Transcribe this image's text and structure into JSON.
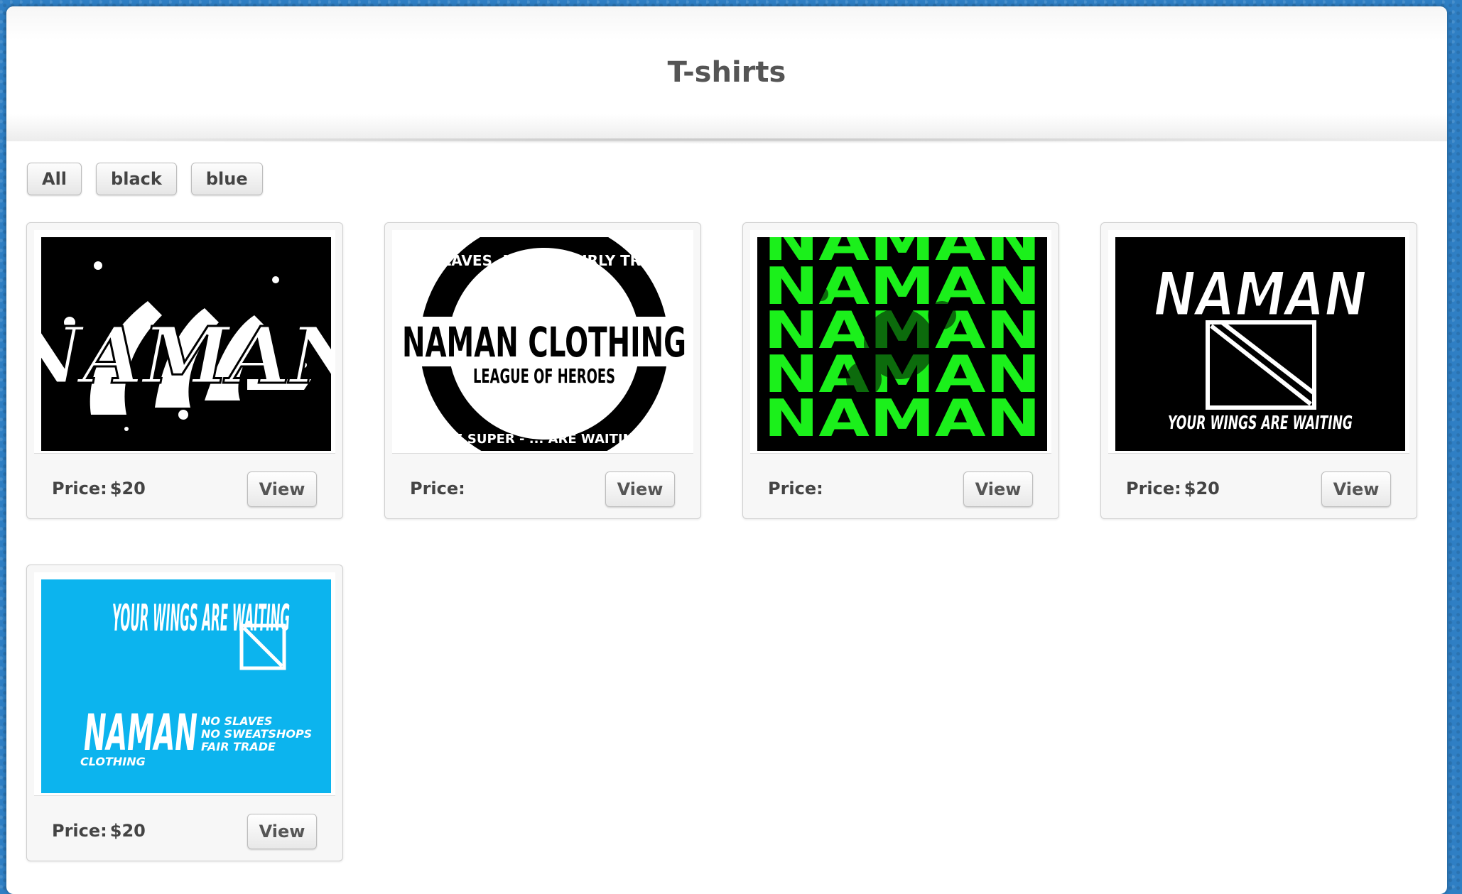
{
  "page": {
    "title": "T-shirts"
  },
  "filters": [
    {
      "label": "All"
    },
    {
      "label": "black"
    },
    {
      "label": "blue"
    }
  ],
  "products": [
    {
      "image_text": "NAMAN",
      "image_bg": "#000000",
      "price_label": "Price:",
      "price_value": "$20",
      "view_label": "View"
    },
    {
      "image_text": "NAMAN CLOTHING",
      "image_subtext": "LEAGUE OF HEROES",
      "image_ring_top": "NO SLAVES. NO S... FAIRLY TRADED",
      "image_ring_bottom": "BE SUPER - ... ARE WAITING",
      "image_bg": "#ffffff",
      "price_label": "Price:",
      "price_value": "",
      "view_label": "View"
    },
    {
      "image_text": "NAMAN",
      "image_bg": "#000000",
      "image_fg": "#1bf01b",
      "price_label": "Price:",
      "price_value": "",
      "view_label": "View"
    },
    {
      "image_text": "NAMAN",
      "image_subtext": "YOUR WINGS ARE WAITING",
      "image_bg": "#000000",
      "price_label": "Price:",
      "price_value": "$20",
      "view_label": "View"
    },
    {
      "image_text": "YOUR WINGS ARE WAITING",
      "image_subtext": "NAMAN",
      "image_small": [
        "CLOTHING",
        "NO SLAVES",
        "NO SWEATSHOPS",
        "FAIR TRADE"
      ],
      "image_bg": "#0cb4ee",
      "price_label": "Price:",
      "price_value": "$20",
      "view_label": "View"
    }
  ]
}
